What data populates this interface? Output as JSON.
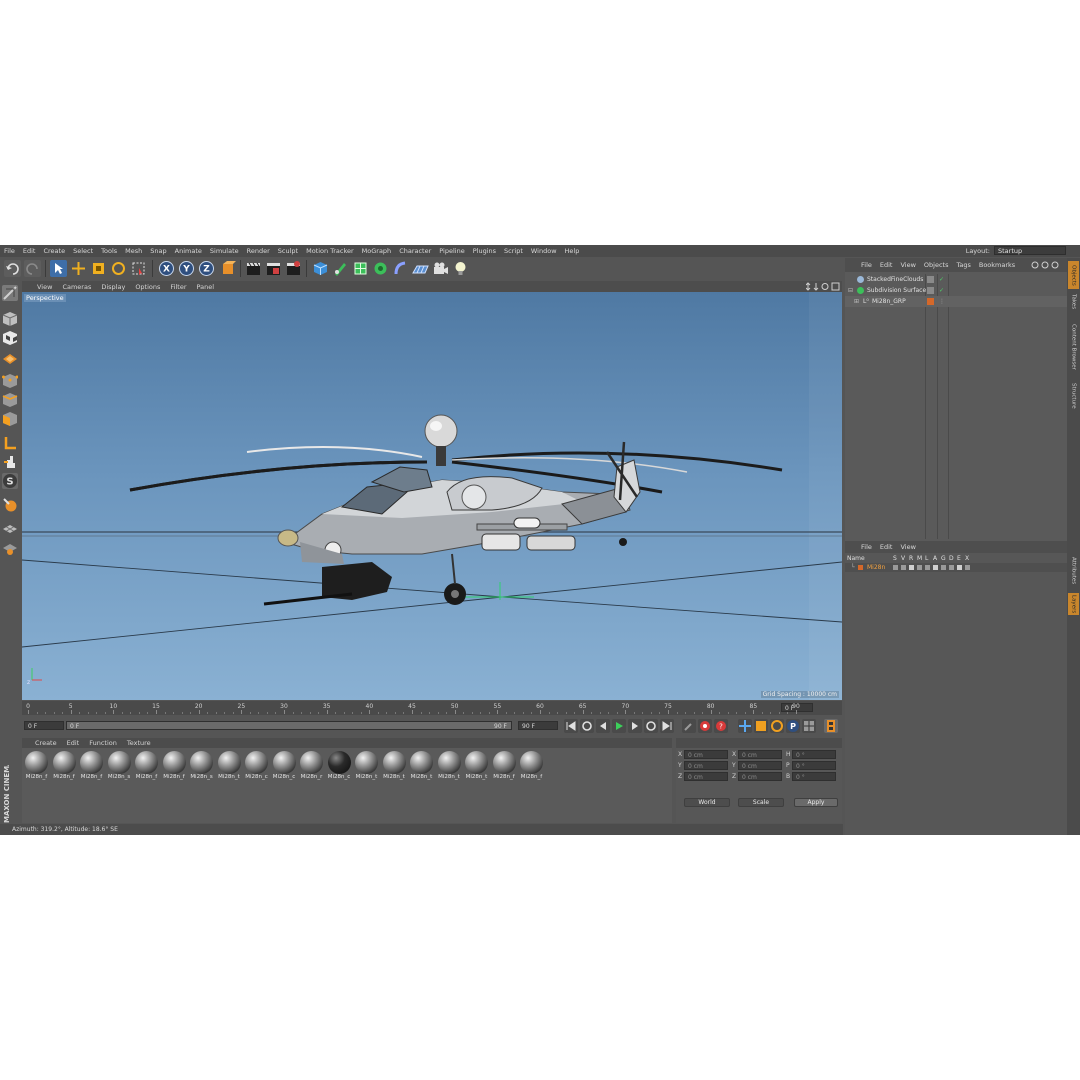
{
  "menu": [
    "File",
    "Edit",
    "Create",
    "Select",
    "Tools",
    "Mesh",
    "Snap",
    "Animate",
    "Simulate",
    "Render",
    "Sculpt",
    "Motion Tracker",
    "MoGraph",
    "Character",
    "Pipeline",
    "Plugins",
    "Script",
    "Window",
    "Help"
  ],
  "layout": {
    "label": "Layout:",
    "value": "Startup"
  },
  "axis_buttons": [
    "X",
    "Y",
    "Z"
  ],
  "viewport": {
    "menu": [
      "View",
      "Cameras",
      "Display",
      "Options",
      "Filter",
      "Panel"
    ],
    "label": "Perspective",
    "grid_spacing": "Grid Spacing : 10000 cm",
    "sky_top": "#4f79a3",
    "sky_bottom": "#8ab1d3"
  },
  "timeline": {
    "ticks": [
      "0",
      "5",
      "10",
      "15",
      "20",
      "25",
      "30",
      "35",
      "40",
      "45",
      "50",
      "55",
      "60",
      "65",
      "70",
      "75",
      "80",
      "85",
      "90"
    ],
    "frame_readout": "0 F",
    "start": "0 F",
    "min": "0 F",
    "max": "90 F",
    "end": "90 F"
  },
  "materials": {
    "menu": [
      "Create",
      "Edit",
      "Function",
      "Texture"
    ],
    "items": [
      "Mi28n_f",
      "Mi28n_f",
      "Mi28n_f",
      "Mi28n_s",
      "Mi28n_f",
      "Mi28n_f",
      "Mi28n_s",
      "Mi28n_t",
      "Mi28n_c",
      "Mi28n_c",
      "Mi28n_r",
      "Mi28n_c",
      "Mi28n_t",
      "Mi28n_t",
      "Mi28n_t",
      "Mi28n_t",
      "Mi28n_t",
      "Mi28n_f",
      "Mi28n_f"
    ]
  },
  "coords": {
    "pos": [
      {
        "axis": "X",
        "value": "0 cm"
      },
      {
        "axis": "Y",
        "value": "0 cm"
      },
      {
        "axis": "Z",
        "value": "0 cm"
      }
    ],
    "size": [
      {
        "axis": "X",
        "value": "0 cm"
      },
      {
        "axis": "Y",
        "value": "0 cm"
      },
      {
        "axis": "Z",
        "value": "0 cm"
      }
    ],
    "rot": [
      {
        "axis": "H",
        "value": "0 °"
      },
      {
        "axis": "P",
        "value": "0 °"
      },
      {
        "axis": "B",
        "value": "0 °"
      }
    ],
    "mode1": "World",
    "mode2": "Scale",
    "apply": "Apply"
  },
  "status": "Azimuth: 319.2°, Altitude: 18.6°  SE",
  "object_manager": {
    "menu": [
      "File",
      "Edit",
      "View",
      "Objects",
      "Tags",
      "Bookmarks"
    ],
    "objects": [
      "StackedFineClouds",
      "Subdivision Surface",
      "Mi28n_GRP"
    ]
  },
  "layer_manager": {
    "menu": [
      "File",
      "Edit",
      "View"
    ],
    "columns": [
      "Name",
      "S",
      "V",
      "R",
      "M",
      "L",
      "A",
      "G",
      "D",
      "E",
      "X"
    ],
    "layers": [
      {
        "name": "Mi28n",
        "color": "#d4682a"
      }
    ]
  },
  "side_tabs": [
    "Objects",
    "Takes",
    "Content Browser",
    "Structure",
    "Attributes",
    "Layers"
  ],
  "brand": "MAXON CINEMA 4D",
  "accent": "#c9862c"
}
